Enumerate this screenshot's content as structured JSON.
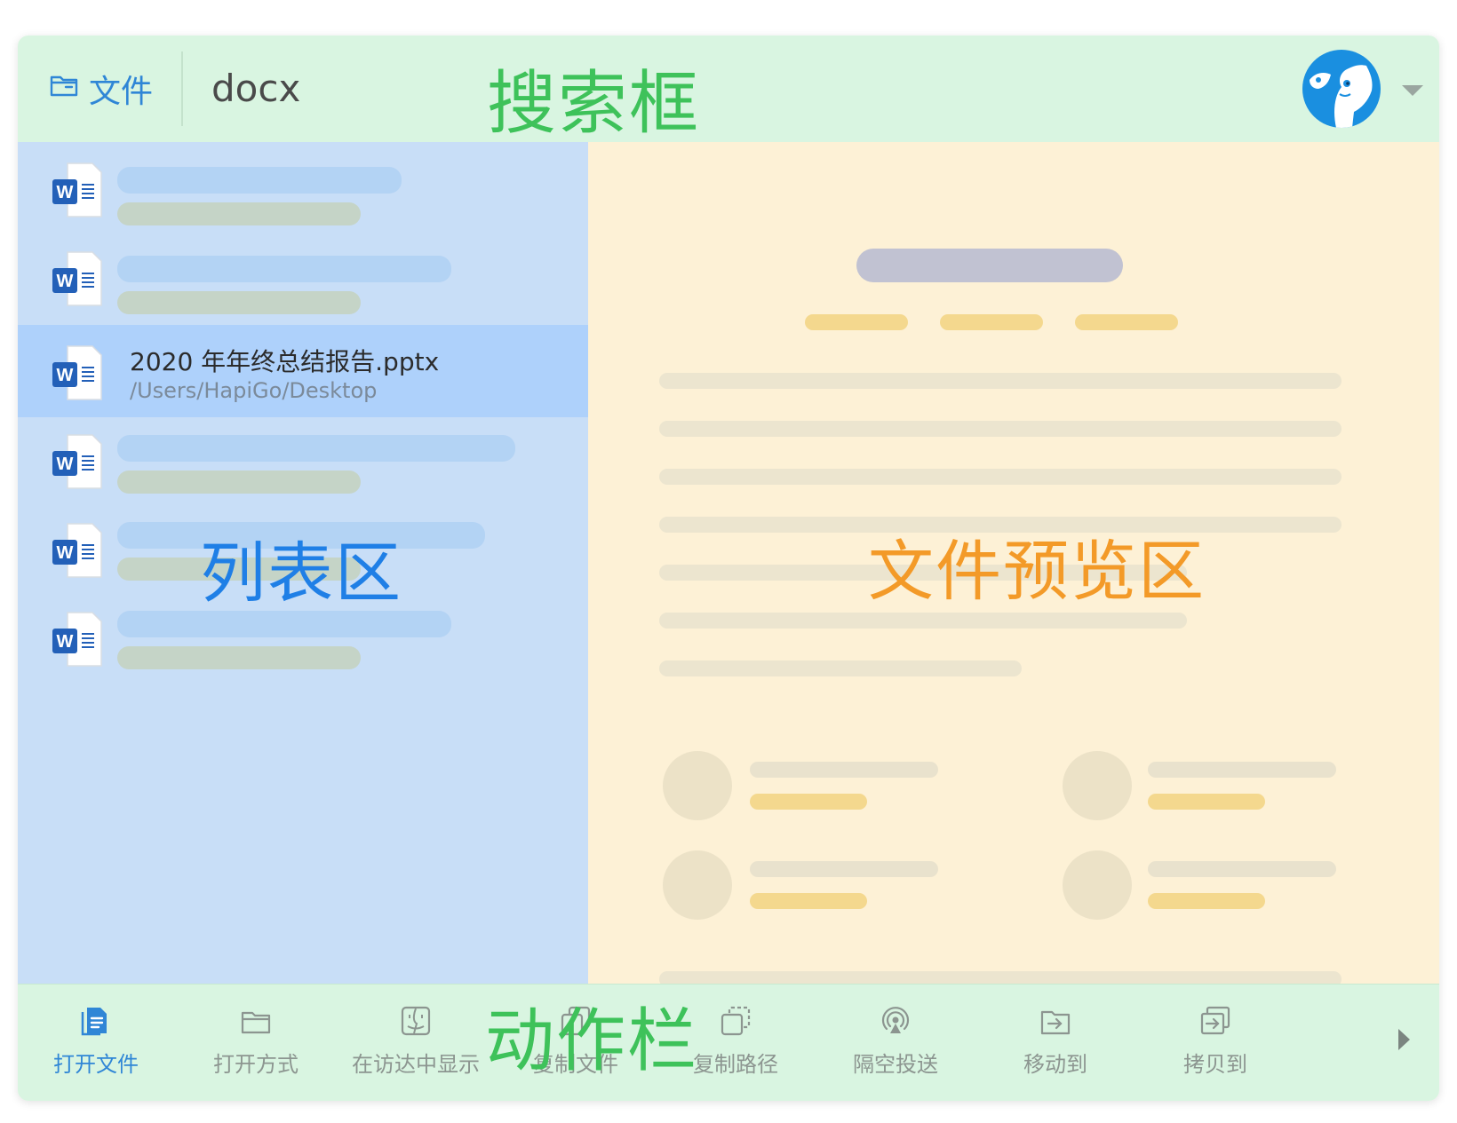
{
  "header": {
    "scope_label": "文件",
    "search_value": "docx",
    "annotation": "搜索框"
  },
  "list": {
    "annotation": "列表区",
    "selected_item": {
      "title": "2020 年年终总结报告.pptx",
      "path": "/Users/HapiGo/Desktop"
    }
  },
  "preview": {
    "annotation": "文件预览区"
  },
  "actions": {
    "annotation": "动作栏",
    "items": [
      {
        "label": "打开文件",
        "icon": "document-icon"
      },
      {
        "label": "打开方式",
        "icon": "folder-icon"
      },
      {
        "label": "在访达中显示",
        "icon": "finder-icon"
      },
      {
        "label": "复制文件",
        "icon": "copy-file-icon"
      },
      {
        "label": "复制路径",
        "icon": "copy-path-icon"
      },
      {
        "label": "隔空投送",
        "icon": "airdrop-icon"
      },
      {
        "label": "移动到",
        "icon": "move-to-folder-icon"
      },
      {
        "label": "拷贝到",
        "icon": "copy-to-icon"
      }
    ]
  },
  "colors": {
    "header_bg": "#d9f5e1",
    "list_bg": "#c8def7",
    "selected_row_bg": "#aed1fb",
    "preview_bg": "#fdf1d6",
    "accent_blue": "#2f86d6",
    "annotation_green": "#3ec25a",
    "annotation_blue": "#1f7fe6",
    "annotation_orange": "#f39a28"
  }
}
